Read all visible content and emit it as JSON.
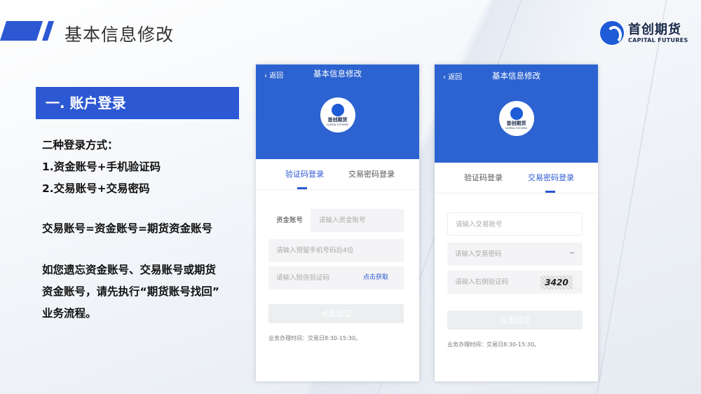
{
  "page": {
    "title": "基本信息修改"
  },
  "logo": {
    "cn": "首创期货",
    "en": "CAPITAL FUTURES"
  },
  "section": {
    "header": "一. 账户登录",
    "methods_title": "二种登录方式：",
    "method_1": "1.资金账号+手机验证码",
    "method_2": "2.交易账号+交易密码",
    "equation": "交易账号=资金账号=期货资金账号",
    "note_line_1": "如您遗忘资金账号、交易账号或期货",
    "note_line_2": "资金账号，请先执行“期货账号找回”",
    "note_line_3": "业务流程。"
  },
  "phone1": {
    "back": "返回",
    "title": "基本信息修改",
    "logo_cn": "首创期货",
    "logo_en": "CAPITAL FUTURES",
    "tab_sms": "验证码登录",
    "tab_pwd": "交易密码登录",
    "account_label": "资金账号",
    "account_placeholder": "请输入资金账号",
    "phone_placeholder": "请输入预留手机号码后4位",
    "sms_placeholder": "请输入短信验证码",
    "get_code": "点击获取",
    "submit": "点击验证",
    "hours": "业务办理时间：交易日8:30-15:30。"
  },
  "phone2": {
    "back": "返回",
    "title": "基本信息修改",
    "logo_cn": "首创期货",
    "logo_en": "CAPITAL FUTURES",
    "tab_sms": "验证码登录",
    "tab_pwd": "交易密码登录",
    "account_placeholder": "请输入交易账号",
    "password_placeholder": "请输入交易密码",
    "captcha_placeholder": "请输入右侧验证码",
    "captcha_text": "3420",
    "submit": "点击验证",
    "hours": "业务办理时间：交易日8:30-15:30。"
  },
  "colors": {
    "accent": "#2c58d3",
    "phone_header": "#2c63d0"
  }
}
